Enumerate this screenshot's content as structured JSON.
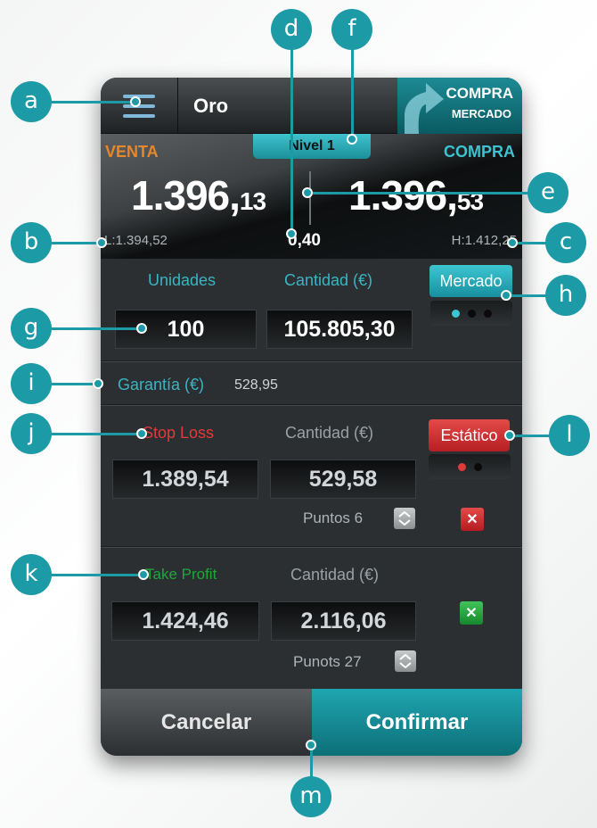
{
  "header": {
    "instrument": "Oro",
    "buy_market_line1": "COMPRA",
    "buy_market_line2": "MERCADO",
    "menu_icon": "hamburger-menu-icon"
  },
  "prices": {
    "level_badge": "Nivel 1",
    "sell_label": "VENTA",
    "buy_label": "COMPRA",
    "sell_price_main": "1.396,",
    "sell_price_small": "13",
    "buy_price_main": "1.396,",
    "buy_price_small": "53",
    "low": "L:1.394,52",
    "spread": "0,40",
    "high": "H:1.412,25"
  },
  "units_section": {
    "units_label": "Unidades",
    "amount_label": "Cantidad (€)",
    "units_value": "100",
    "amount_value": "105.805,30",
    "order_type_button": "Mercado",
    "guarantee_label": "Garantía (€)",
    "guarantee_value": "528,95"
  },
  "stop_loss": {
    "label": "Stop Loss",
    "amount_label": "Cantidad (€)",
    "price_value": "1.389,54",
    "amount_value": "529,58",
    "points_text": "Puntos 6",
    "mode_button": "Estático"
  },
  "take_profit": {
    "label": "Take Profit",
    "amount_label": "Cantidad (€)",
    "price_value": "1.424,46",
    "amount_value": "2.116,06",
    "points_text": "Punots 27"
  },
  "footer": {
    "cancel": "Cancelar",
    "confirm": "Confirmar"
  },
  "callouts": [
    "a",
    "b",
    "c",
    "d",
    "e",
    "f",
    "g",
    "h",
    "i",
    "j",
    "k",
    "l",
    "m"
  ],
  "colors": {
    "accent_teal": "#1c9aa6",
    "sell_orange": "#e8862a",
    "stop_loss_red": "#e23a3a",
    "take_profit_green": "#1fa83a",
    "panel_dark": "#2b2f31"
  }
}
